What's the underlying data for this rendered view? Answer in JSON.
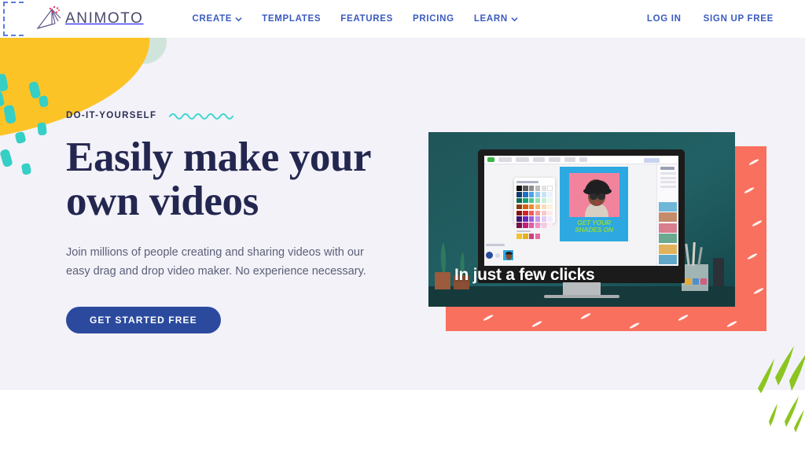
{
  "brand": {
    "name": "ANIMOTO",
    "logo_icon": "animoto-fan-logo"
  },
  "nav": {
    "links": [
      {
        "label": "CREATE",
        "has_caret": true,
        "icon": "chevron-down-icon"
      },
      {
        "label": "TEMPLATES",
        "has_caret": false
      },
      {
        "label": "FEATURES",
        "has_caret": false
      },
      {
        "label": "PRICING",
        "has_caret": false
      },
      {
        "label": "LEARN",
        "has_caret": true,
        "icon": "chevron-down-icon"
      }
    ],
    "login_label": "LOG IN",
    "signup_label": "SIGN UP FREE"
  },
  "hero": {
    "eyebrow": "DO-IT-YOURSELF",
    "headline_line1": "Easily make your",
    "headline_line2": "own videos",
    "subcopy": "Join millions of people creating and sharing videos with our easy drag and drop video maker. No experience necessary.",
    "cta_label": "GET STARTED FREE"
  },
  "media": {
    "caption": "In just a few clicks",
    "canvas_text_line1": "GET YOUR",
    "canvas_text_line2": "SHADES ON"
  },
  "colors": {
    "hero_bg": "#f3f2f8",
    "page_bg": "#ffffff",
    "nav_link": "#3a5bbf",
    "headline": "#232750",
    "subcopy": "#5c6079",
    "cta_bg": "#2b4a9e",
    "cta_text": "#ffffff",
    "eyebrow": "#2b2e58",
    "accent_yellow": "#fcc327",
    "accent_teal": "#35cfc6",
    "accent_coral": "#f9705e",
    "accent_green": "#8cc520",
    "accent_mint": "#cfe5dc",
    "logo_text": "#4a4a6a",
    "squiggle": "#3dd6d0",
    "video_room": "#1d4f52",
    "canvas_blue": "#2ea8e0",
    "canvas_pink": "#f2839c",
    "canvas_text": "#8fd93f"
  }
}
